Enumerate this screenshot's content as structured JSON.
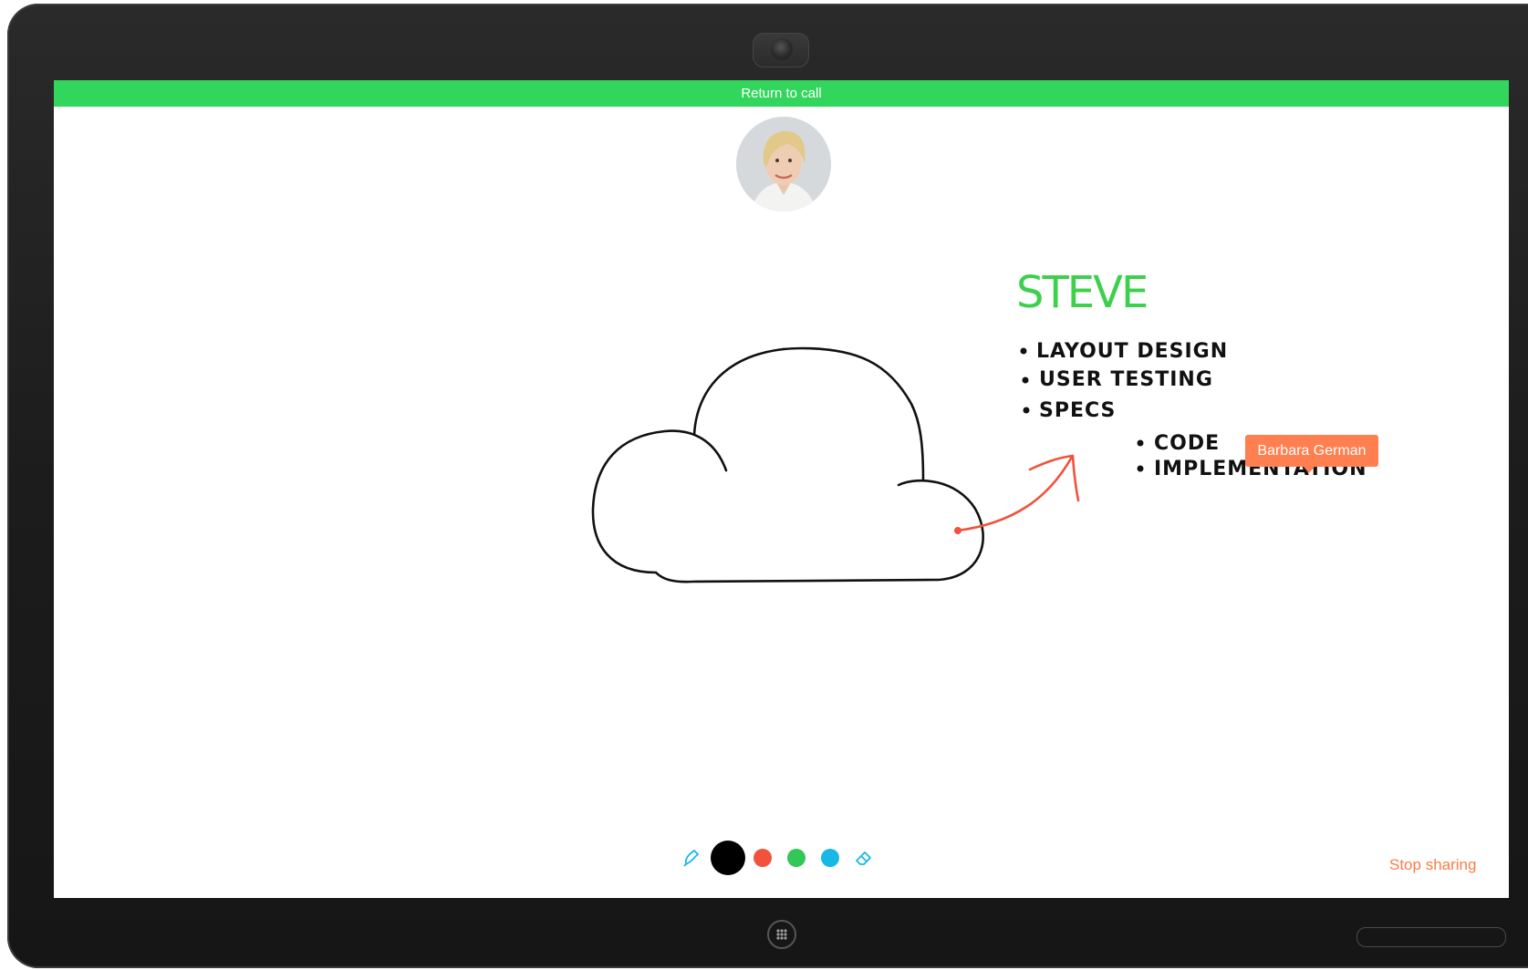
{
  "device": {
    "camera_icon": "camera-icon",
    "home_icon": "app-grid-icon"
  },
  "call": {
    "return_label": "Return to call"
  },
  "whiteboard": {
    "heading": "STEVE",
    "list_main": [
      "LAYOUT DESIGN",
      "USER TESTING",
      "SPECS"
    ],
    "list_sub": [
      "CODE",
      "IMPLEMENTATION"
    ],
    "pointer_user": "Barbara German",
    "colors": {
      "heading": "#3fcf4e",
      "ink": "#111111",
      "arrow": "#f2513c"
    }
  },
  "toolbar": {
    "pen_icon": "pen-icon",
    "eraser_icon": "eraser-icon",
    "colors": [
      "#000000",
      "#f2513c",
      "#33c75a",
      "#18b8e6"
    ],
    "selected_color": "#000000",
    "stop_sharing_label": "Stop sharing"
  },
  "colors": {
    "accent_green": "#33d65c",
    "accent_orange": "#ff7a45",
    "bezel": "#1c1c1c"
  }
}
